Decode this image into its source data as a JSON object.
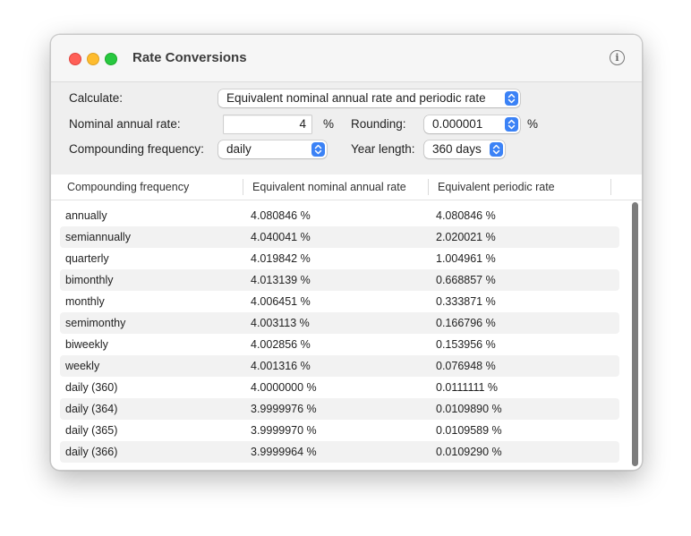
{
  "window": {
    "title": "Rate Conversions"
  },
  "form": {
    "calculate_label": "Calculate:",
    "calculate_value": "Equivalent nominal annual rate and periodic rate",
    "nominal_label": "Nominal annual rate:",
    "nominal_value": "4",
    "nominal_unit": "%",
    "rounding_label": "Rounding:",
    "rounding_value": "0.000001",
    "rounding_unit": "%",
    "frequency_label": "Compounding frequency:",
    "frequency_value": "daily",
    "year_label": "Year length:",
    "year_value": "360 days"
  },
  "table": {
    "headers": [
      "Compounding frequency",
      "Equivalent nominal annual rate",
      "Equivalent periodic rate"
    ],
    "rows": [
      [
        "annually",
        "4.080846 %",
        "4.080846 %"
      ],
      [
        "semiannually",
        "4.040041 %",
        "2.020021 %"
      ],
      [
        "quarterly",
        "4.019842 %",
        "1.004961 %"
      ],
      [
        "bimonthly",
        "4.013139 %",
        "0.668857 %"
      ],
      [
        "monthly",
        "4.006451 %",
        "0.333871 %"
      ],
      [
        "semimonthy",
        "4.003113 %",
        "0.166796 %"
      ],
      [
        "biweekly",
        "4.002856 %",
        "0.153956 %"
      ],
      [
        "weekly",
        "4.001316 %",
        "0.076948 %"
      ],
      [
        "daily (360)",
        "4.0000000 %",
        "0.0111111 %"
      ],
      [
        "daily (364)",
        "3.9999976 %",
        "0.0109890 %"
      ],
      [
        "daily (365)",
        "3.9999970 %",
        "0.0109589 %"
      ],
      [
        "daily (366)",
        "3.9999964 %",
        "0.0109290 %"
      ]
    ]
  },
  "colors": {
    "accent": "#3b82f6",
    "close": "#ff5f57",
    "minimize": "#febc2e",
    "zoom": "#28c840"
  }
}
